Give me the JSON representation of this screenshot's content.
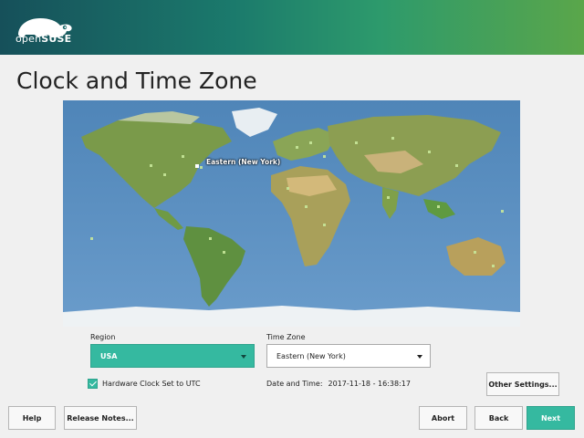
{
  "header": {
    "logo_text_light": "open",
    "logo_text_bold": "SUSE"
  },
  "page": {
    "title": "Clock and Time Zone"
  },
  "map": {
    "marker_label": "Eastern (New York)"
  },
  "region": {
    "label": "Region",
    "value": "USA"
  },
  "timezone": {
    "label": "Time Zone",
    "value": "Eastern (New York)"
  },
  "hardware_clock": {
    "label": "Hardware Clock Set to UTC",
    "checked": true
  },
  "datetime": {
    "label": "Date and Time:",
    "value": "2017-11-18 - 16:38:17"
  },
  "buttons": {
    "other_settings": "Other Settings...",
    "help": "Help",
    "release_notes": "Release Notes...",
    "abort": "Abort",
    "back": "Back",
    "next": "Next"
  },
  "colors": {
    "accent": "#35b9a0",
    "header_start": "#16505a",
    "header_end": "#5aa64a"
  }
}
